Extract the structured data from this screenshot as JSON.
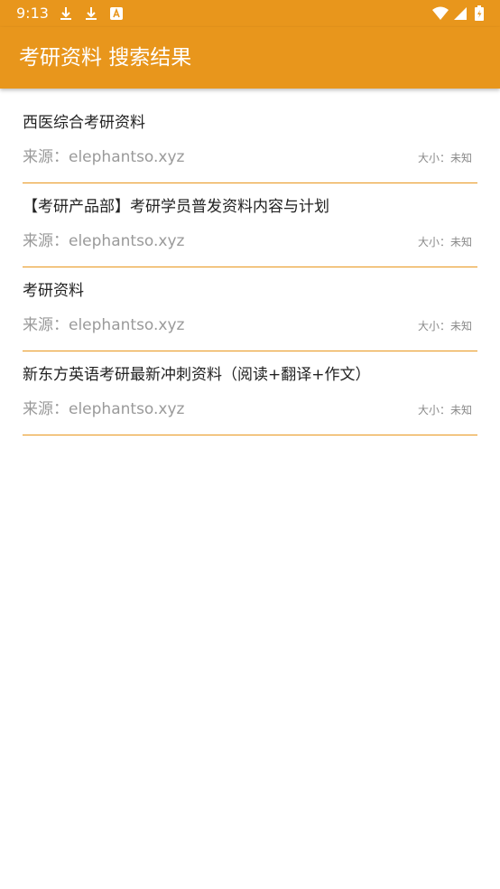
{
  "status_bar": {
    "time": "9:13",
    "icons": [
      "download-icon",
      "download-icon",
      "font-icon",
      "wifi-icon",
      "signal-icon",
      "battery-icon"
    ]
  },
  "app_bar": {
    "title": "考研资料 搜索结果"
  },
  "results": [
    {
      "title": "西医综合考研资料",
      "source": "来源：elephantso.xyz",
      "size": "大小：未知"
    },
    {
      "title": "【考研产品部】考研学员普发资料内容与计划",
      "source": "来源：elephantso.xyz",
      "size": "大小：未知"
    },
    {
      "title": "考研资料",
      "source": "来源：elephantso.xyz",
      "size": "大小：未知"
    },
    {
      "title": "新东方英语考研最新冲刺资料（阅读+翻译+作文）",
      "source": "来源：elephantso.xyz",
      "size": "大小：未知"
    }
  ],
  "colors": {
    "accent": "#e8961c",
    "title_text": "#222222",
    "secondary_text": "#9a9a9a"
  }
}
